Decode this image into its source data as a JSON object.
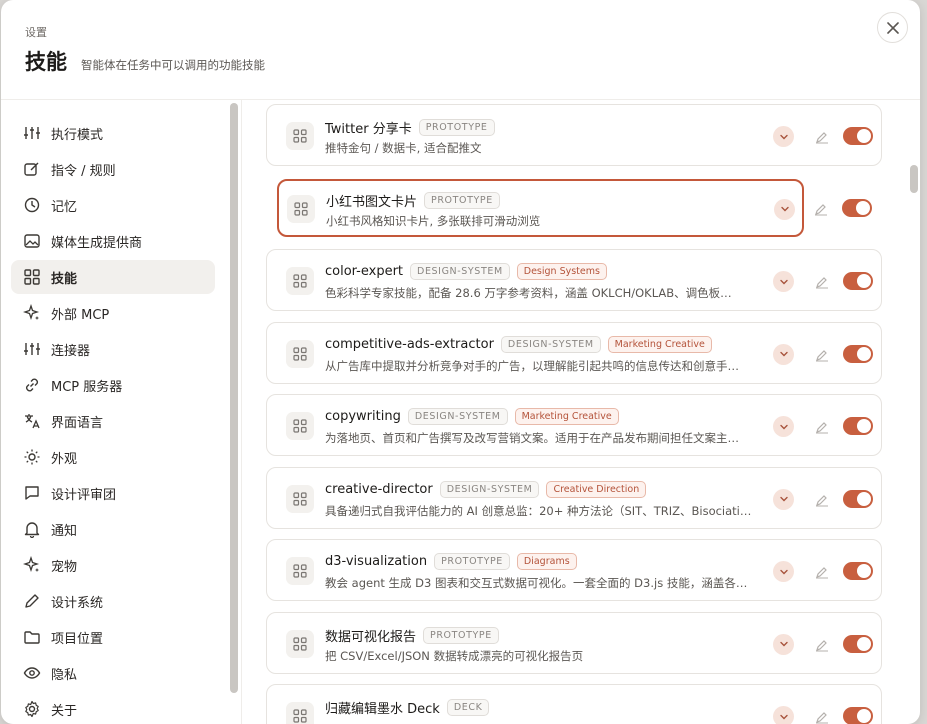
{
  "header": {
    "eyebrow": "设置",
    "title": "技能",
    "subtitle": "智能体在任务中可以调用的功能技能",
    "close_icon": "close-icon"
  },
  "sidebar": {
    "items": [
      {
        "label": "执行模式",
        "icon": "sliders-icon"
      },
      {
        "label": "指令 / 规则",
        "icon": "edit-square-icon"
      },
      {
        "label": "记忆",
        "icon": "history-icon"
      },
      {
        "label": "媒体生成提供商",
        "icon": "image-icon"
      },
      {
        "label": "技能",
        "icon": "grid-icon",
        "active": true
      },
      {
        "label": "外部 MCP",
        "icon": "sparkle-icon"
      },
      {
        "label": "连接器",
        "icon": "sliders-icon"
      },
      {
        "label": "MCP 服务器",
        "icon": "link-icon"
      },
      {
        "label": "界面语言",
        "icon": "translate-icon"
      },
      {
        "label": "外观",
        "icon": "sun-icon"
      },
      {
        "label": "设计评审团",
        "icon": "chat-bubble-icon"
      },
      {
        "label": "通知",
        "icon": "bell-icon"
      },
      {
        "label": "宠物",
        "icon": "sparkle-icon"
      },
      {
        "label": "设计系统",
        "icon": "pencil-icon"
      },
      {
        "label": "项目位置",
        "icon": "folder-icon"
      },
      {
        "label": "隐私",
        "icon": "eye-icon"
      },
      {
        "label": "关于",
        "icon": "gear-icon"
      }
    ]
  },
  "skills": [
    {
      "title": "Twitter 分享卡",
      "tags": [
        "PROTOTYPE"
      ],
      "category": "",
      "desc": "推特金句 / 数据卡, 适合配推文",
      "enabled": true
    },
    {
      "title": "小红书图文卡片",
      "tags": [
        "PROTOTYPE"
      ],
      "category": "",
      "desc": "小红书风格知识卡片, 多张联排可滑动浏览",
      "enabled": true,
      "highlighted": true
    },
    {
      "title": "color-expert",
      "tags": [
        "DESIGN-SYSTEM"
      ],
      "category": "Design Systems",
      "desc": "色彩科学专家技能，配备 28.6 万字参考资料，涵盖 OKLCH/OKLAB、调色板…",
      "enabled": true
    },
    {
      "title": "competitive-ads-extractor",
      "tags": [
        "DESIGN-SYSTEM"
      ],
      "category": "Marketing Creative",
      "desc": "从广告库中提取并分析竞争对手的广告，以理解能引起共鸣的信息传达和创意手…",
      "enabled": true
    },
    {
      "title": "copywriting",
      "tags": [
        "DESIGN-SYSTEM"
      ],
      "category": "Marketing Creative",
      "desc": "为落地页、首页和广告撰写及改写营销文案。适用于在产品发布期间担任文案主…",
      "enabled": true
    },
    {
      "title": "creative-director",
      "tags": [
        "DESIGN-SYSTEM"
      ],
      "category": "Creative Direction",
      "desc": "具备递归式自我评估能力的 AI 创意总监：20+ 种方法论（SIT、TRIZ、Bisociati…",
      "enabled": true
    },
    {
      "title": "d3-visualization",
      "tags": [
        "PROTOTYPE"
      ],
      "category": "Diagrams",
      "desc": "教会 agent 生成 D3 图表和交互式数据可视化。一套全面的 D3.js 技能，涵盖各…",
      "enabled": true
    },
    {
      "title": "数据可视化报告",
      "tags": [
        "PROTOTYPE"
      ],
      "category": "",
      "desc": "把 CSV/Excel/JSON 数据转成漂亮的可视化报告页",
      "enabled": true
    },
    {
      "title": "归藏编辑墨水 Deck",
      "tags": [
        "DECK"
      ],
      "category": "",
      "desc": "",
      "enabled": true
    }
  ],
  "colors": {
    "accent": "#c85f3f",
    "highlight_border": "#c4583a"
  }
}
